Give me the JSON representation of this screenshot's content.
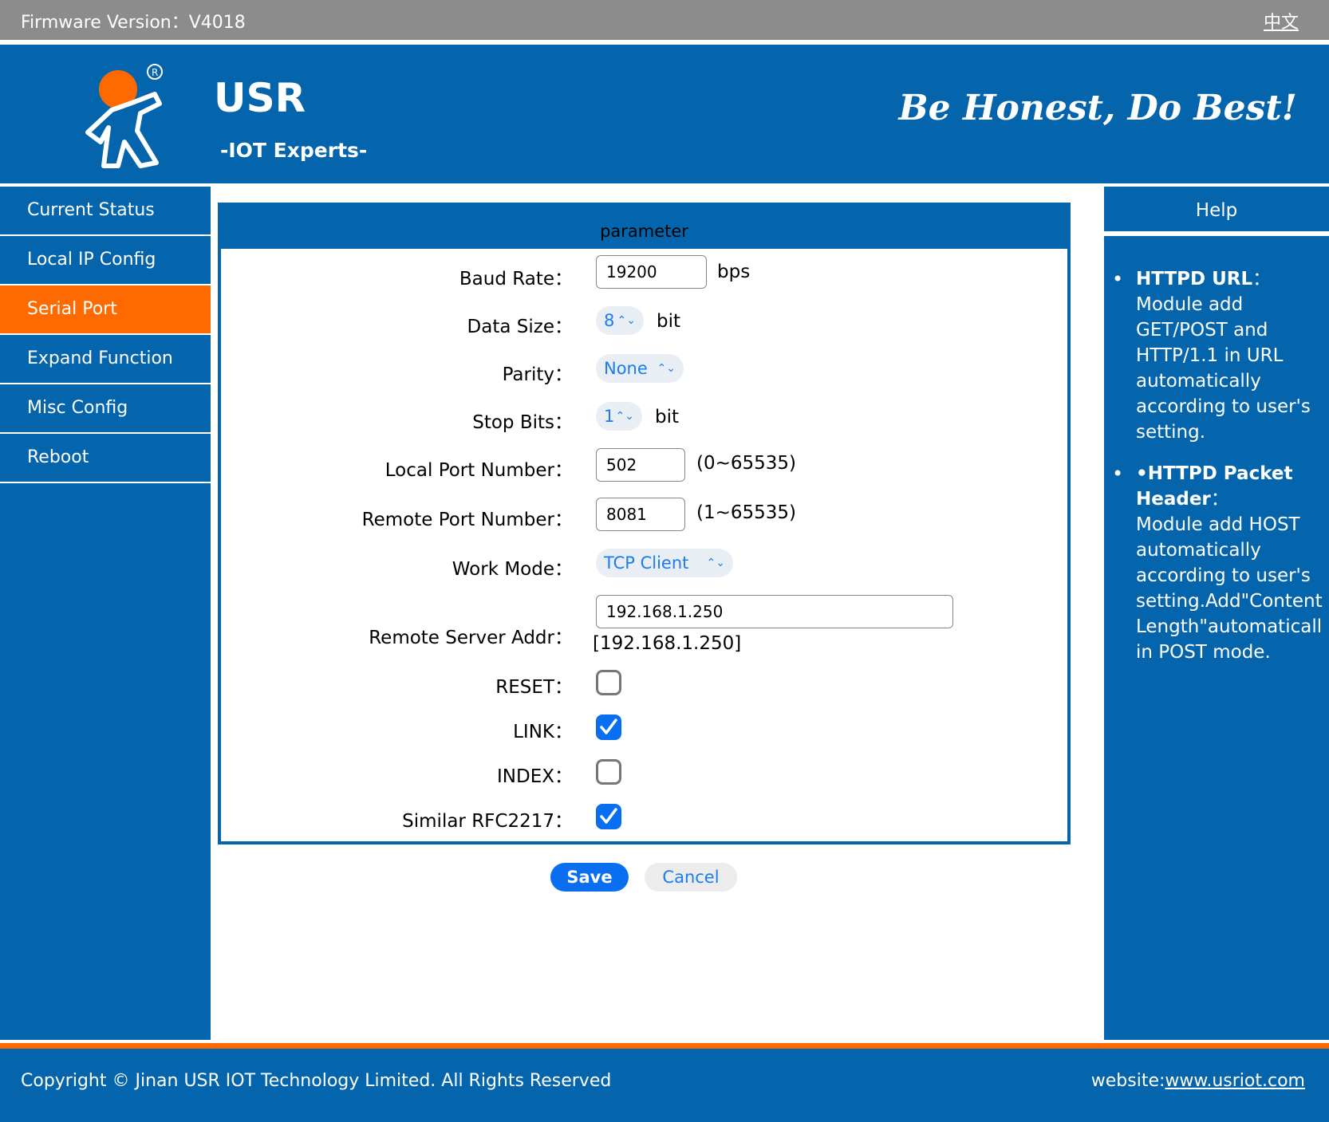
{
  "topbar": {
    "firmware": "Firmware Version：V4018",
    "lang": "中文"
  },
  "header": {
    "brand": "USR",
    "tagline": "-IOT Experts-",
    "motto": "Be Honest, Do Best!"
  },
  "sidebar": {
    "items": [
      {
        "label": "Current Status"
      },
      {
        "label": "Local IP Config"
      },
      {
        "label": "Serial Port"
      },
      {
        "label": "Expand Function"
      },
      {
        "label": "Misc Config"
      },
      {
        "label": "Reboot"
      }
    ],
    "active": "Serial Port"
  },
  "panel": {
    "title": "parameter",
    "baud_rate": {
      "label": "Baud Rate：",
      "value": "19200",
      "unit": "bps"
    },
    "data_size": {
      "label": "Data Size：",
      "value": "8",
      "unit": "bit"
    },
    "parity": {
      "label": "Parity：",
      "value": "None"
    },
    "stop_bits": {
      "label": "Stop Bits：",
      "value": "1",
      "unit": "bit"
    },
    "local_port": {
      "label": "Local Port Number：",
      "value": "502",
      "range": "(0~65535)"
    },
    "remote_port": {
      "label": "Remote Port Number：",
      "value": "8081",
      "range": "(1~65535)"
    },
    "work_mode": {
      "label": "Work Mode：",
      "value": "TCP Client"
    },
    "remote_addr": {
      "label": "Remote Server Addr：",
      "value": "192.168.1.250",
      "resolved": "[192.168.1.250]"
    },
    "reset": {
      "label": "RESET：",
      "checked": false
    },
    "link": {
      "label": "LINK：",
      "checked": true
    },
    "index": {
      "label": "INDEX：",
      "checked": false
    },
    "rfc2217": {
      "label": "Similar RFC2217：",
      "checked": true
    }
  },
  "buttons": {
    "save": "Save",
    "cancel": "Cancel"
  },
  "help": {
    "title": "Help",
    "items": [
      {
        "heading": "HTTPD URL",
        "suffix": "：",
        "lines": [
          "Module add",
          "GET/POST and",
          "HTTP/1.1 in URL",
          "automatically",
          "according to user's",
          "setting."
        ]
      },
      {
        "heading": "•HTTPD Packet",
        "heading2": "Header",
        "suffix": "：",
        "lines": [
          "Module add HOST",
          "automatically",
          "according to user's",
          "setting.Add\"Content",
          "Length\"automaticall",
          "in POST mode."
        ]
      }
    ]
  },
  "footer": {
    "copyright": "Copyright © Jinan USR IOT Technology Limited. All Rights Reserved",
    "website_label": "website:",
    "website": "www.usriot.com"
  },
  "colors": {
    "primary": "#0565ac",
    "accent": "#fe6a00",
    "topbar": "#8c8c8c",
    "control_blue": "#0a6ef0"
  }
}
